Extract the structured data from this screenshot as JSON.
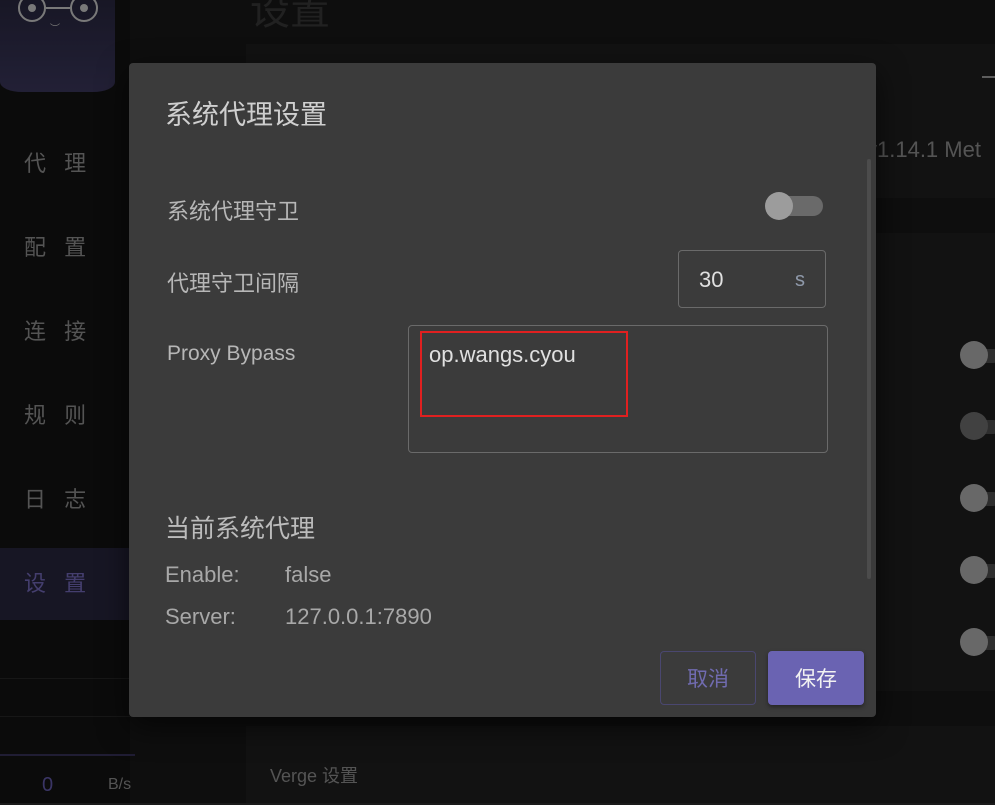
{
  "sidebar": {
    "items": [
      {
        "label": "代 理"
      },
      {
        "label": "配 置"
      },
      {
        "label": "连 接"
      },
      {
        "label": "规 则"
      },
      {
        "label": "日 志"
      },
      {
        "label": "设 置"
      }
    ],
    "traffic_value": "0",
    "traffic_unit": "B/s"
  },
  "main": {
    "title": "设置",
    "version_text": "v1.14.1 Met",
    "verge_section": "Verge 设置"
  },
  "dialog": {
    "title": "系统代理设置",
    "guard_label": "系统代理守卫",
    "guard_enabled": false,
    "interval_label": "代理守卫间隔",
    "interval_value": "30",
    "interval_unit": "s",
    "bypass_label": "Proxy Bypass",
    "bypass_value": "op.wangs.cyou",
    "current_title": "当前系统代理",
    "enable_label": "Enable:",
    "enable_value": "false",
    "server_label": "Server:",
    "server_value": "127.0.0.1:7890",
    "cancel_label": "取消",
    "save_label": "保存"
  },
  "colors": {
    "accent": "#6a63b2",
    "highlight": "#e02020"
  }
}
